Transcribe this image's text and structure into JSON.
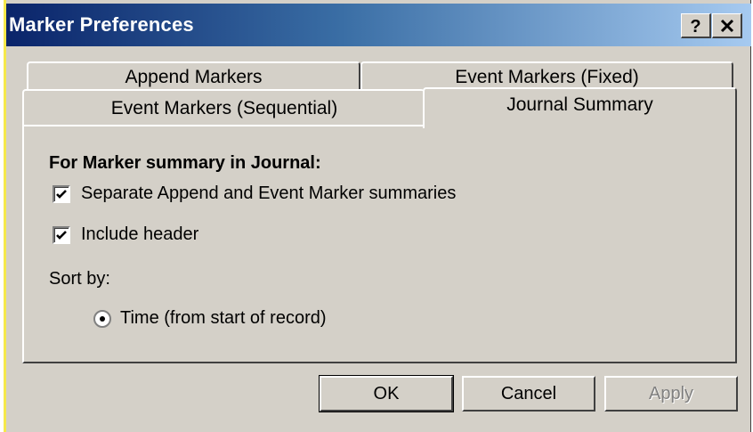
{
  "window": {
    "title": "Marker Preferences",
    "help_label": "?",
    "close_label": "✕"
  },
  "tabs": [
    {
      "label": "Append Markers"
    },
    {
      "label": "Event Markers (Fixed)"
    },
    {
      "label": "Event Markers (Sequential)"
    },
    {
      "label": "Journal Summary",
      "selected": true
    }
  ],
  "panel": {
    "heading": "For Marker summary in Journal:",
    "checkboxes": [
      {
        "label": "Separate Append and Event Marker summaries",
        "checked": true
      },
      {
        "label": "Include header",
        "checked": true
      }
    ],
    "sort_label": "Sort by:",
    "radio": {
      "label": "Time (from start of record)",
      "selected": true
    }
  },
  "buttons": {
    "ok": "OK",
    "cancel": "Cancel",
    "apply": "Apply"
  },
  "colors": {
    "titlebar_start": "#0a246a",
    "titlebar_end": "#a6caf0",
    "face": "#d4d0c8"
  },
  "icons": {
    "help": "help-icon",
    "close": "close-icon",
    "check": "checkmark-icon",
    "radio": "radio-dot-icon"
  }
}
